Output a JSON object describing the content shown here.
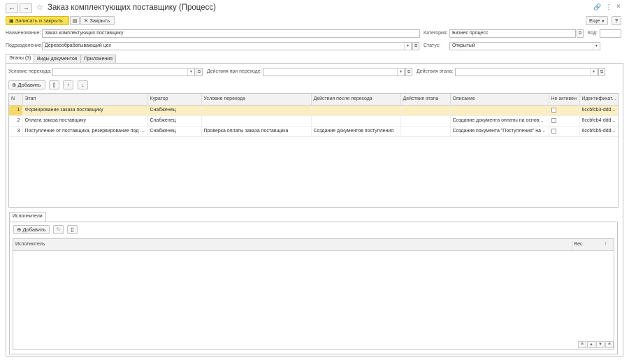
{
  "window": {
    "title": "Заказ комплектующих поставщику (Процесс)",
    "back_icon": "←",
    "forward_icon": "→",
    "star_icon": "☆",
    "link_icon": "🔗",
    "menu_icon": "⋮",
    "close_icon": "×"
  },
  "toolbar": {
    "save_close_label": "Записать и закрыть",
    "save_icon": "💾",
    "close_label": "Закрыть",
    "more_label": "Еще",
    "help_label": "?"
  },
  "header": {
    "name_label": "Наименование:",
    "name_value": "Заказ комплектующих поставщику",
    "category_label": "Категория:",
    "category_value": "Бизнес процесс",
    "code_label": "Код:",
    "code_value": "",
    "division_label": "Подразделение:",
    "division_value": "Деревообрабатывающий цех",
    "status_label": "Статус:",
    "status_value": "Открытый"
  },
  "tabs": [
    {
      "label": "Этапы (3)"
    },
    {
      "label": "Виды документов"
    },
    {
      "label": "Приложения"
    }
  ],
  "filters": {
    "condition_label": "Условие перехода:",
    "actions_transition_label": "Действия при переходе:",
    "actions_stage_label": "Действия этапа:"
  },
  "stages_toolbar": {
    "add_label": "Добавить"
  },
  "stages_table": {
    "columns": [
      "N",
      "Этап",
      "Куратор",
      "Условие перехода",
      "Действия после перехода",
      "Действия этапа",
      "Описание",
      "Не активен",
      "Идентификат..."
    ],
    "rows": [
      {
        "n": "1",
        "stage": "Формирование заказа поставщику",
        "curator": "Снабженец",
        "condition": "",
        "after": "",
        "stage_actions": "",
        "description": "",
        "inactive": "",
        "id": "6ccbfcb3-ddd..."
      },
      {
        "n": "2",
        "stage": "Оплата заказа поставщику",
        "curator": "Снабженец",
        "condition": "",
        "after": "",
        "stage_actions": "",
        "description": "Создание документа оплаты на основ...",
        "inactive": "",
        "id": "6ccbfcb4-ddd..."
      },
      {
        "n": "3",
        "stage": "Поступление от поставщика, резервирование под з...",
        "curator": "Снабженец",
        "condition": "Проверка оплаты заказа поставщика",
        "after": "Создание документов поступления",
        "stage_actions": "",
        "description": "Создание покумента \"Поступления\" на ...",
        "inactive": "",
        "id": "6ccbfcb5-ddd..."
      }
    ],
    "selected_row": 0
  },
  "performers": {
    "tab_label": "Исполнители",
    "add_label": "Добавить",
    "columns": [
      "Исполнитель",
      "Вес"
    ],
    "sort_icon": "↑",
    "pager": [
      "≚",
      "▲",
      "▼",
      "≚"
    ]
  }
}
